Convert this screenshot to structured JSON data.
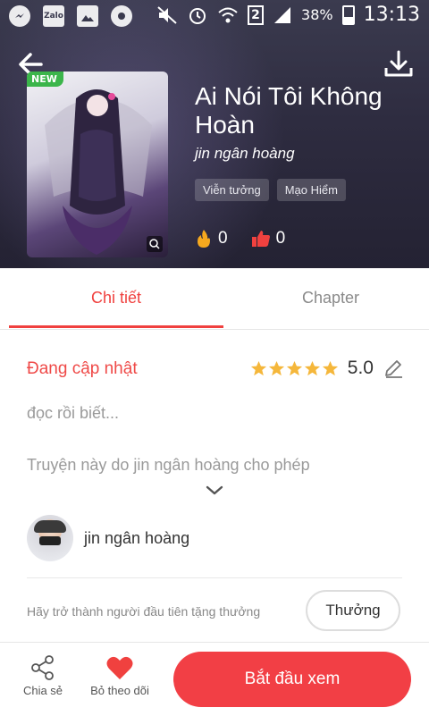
{
  "status_bar": {
    "zalo_label": "Zalo",
    "sim_label": "2",
    "battery_pct": "38%",
    "time": "13:13"
  },
  "header": {
    "new_badge": "NEW",
    "title": "Ai Nói Tôi Không Hoàn",
    "author": "jin ngân hoàng",
    "tags": [
      "Viễn tưởng",
      "Mạo Hiểm"
    ],
    "fire_count": "0",
    "like_count": "0"
  },
  "tabs": [
    {
      "label": "Chi tiết",
      "active": true
    },
    {
      "label": "Chapter",
      "active": false
    }
  ],
  "details": {
    "status": "Đang cập nhật",
    "stars": 5,
    "rating": "5.0",
    "description": "đọc rồi biết...",
    "permission": "Truyện này do jin ngân hoàng cho phép",
    "uploader_name": "jin ngân hoàng",
    "reward_text": "Hãy trở thành người đầu tiên tặng thưởng",
    "reward_button": "Thưởng"
  },
  "bottom_bar": {
    "share_label": "Chia sẻ",
    "follow_label": "Bỏ theo dõi",
    "start_label": "Bắt đầu xem"
  },
  "colors": {
    "accent": "#f23f45",
    "star": "#f5b73b",
    "tag_green": "#3bb54a"
  }
}
